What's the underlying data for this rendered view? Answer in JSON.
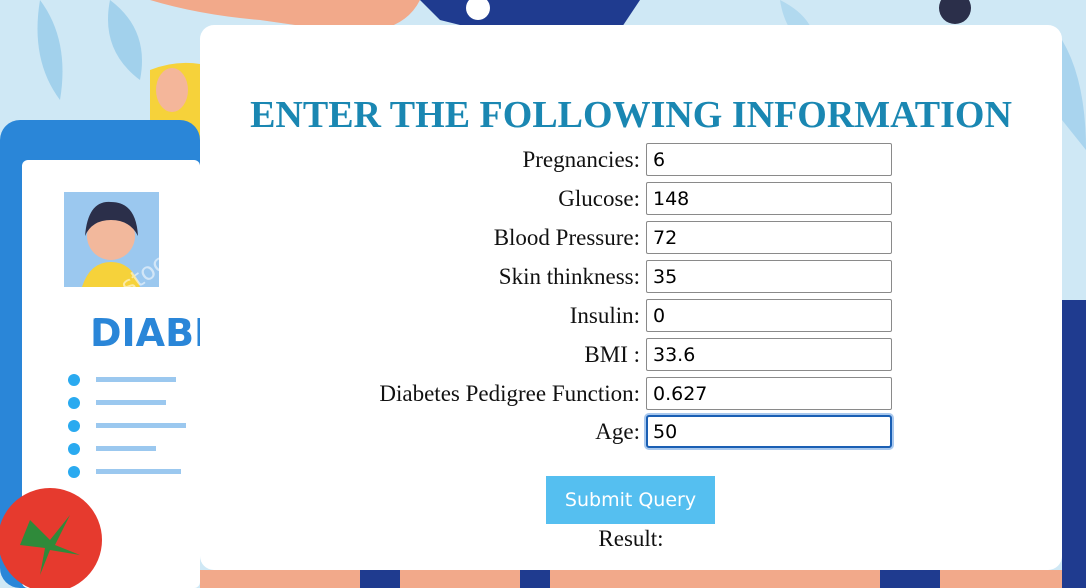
{
  "page": {
    "title": "ENTER THE FOLLOWING INFORMATION",
    "result_label": "Result:",
    "submit_label": "Submit Query"
  },
  "background": {
    "card_text": "DIABE",
    "watermark": "Suraveva stock"
  },
  "form": {
    "fields": [
      {
        "label": "Pregnancies:",
        "value": "6"
      },
      {
        "label": "Glucose:",
        "value": "148"
      },
      {
        "label": "Blood Pressure:",
        "value": "72"
      },
      {
        "label": "Skin thinkness:",
        "value": "35"
      },
      {
        "label": "Insulin:",
        "value": "0"
      },
      {
        "label": "BMI :",
        "value": "33.6"
      },
      {
        "label": "Diabetes Pedigree Function:",
        "value": "0.627"
      },
      {
        "label": "Age:",
        "value": "50",
        "focused": true
      }
    ]
  },
  "colors": {
    "title": "#1a87b2",
    "submit_bg": "#55bff0",
    "background": "#cfe8f5"
  }
}
